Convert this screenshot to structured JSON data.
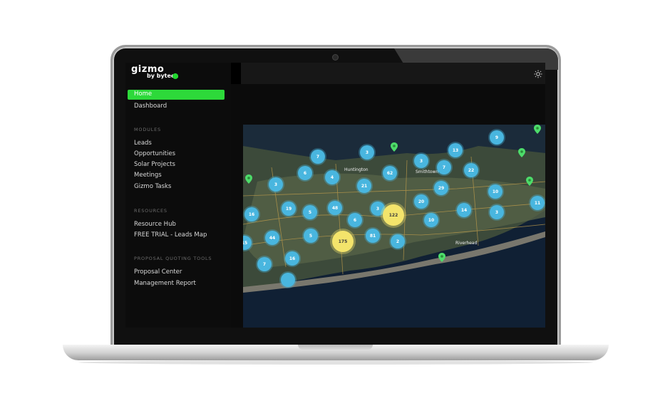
{
  "brand": {
    "name": "gizmo",
    "sub": "by bytech"
  },
  "sidebar": {
    "home": "Home",
    "dashboard": "Dashboard",
    "sections": [
      {
        "label": "MODULES",
        "items": [
          "Leads",
          "Opportunities",
          "Solar Projects",
          "Meetings",
          "Gizmo Tasks"
        ]
      },
      {
        "label": "RESOURCES",
        "items": [
          "Resource Hub",
          "FREE TRIAL - Leads Map"
        ]
      },
      {
        "label": "PROPOSAL QUOTING TOOLS",
        "items": [
          "Proposal Center",
          "Management Report"
        ]
      }
    ]
  },
  "map": {
    "labels": {
      "huntington": "Huntington",
      "smithtown": "Smithtown",
      "riverhead": "Riverhead"
    },
    "clusters": [
      "7",
      "3",
      "3",
      "13",
      "9",
      "6",
      "4",
      "62",
      "7",
      "22",
      "3",
      "21",
      "29",
      "10",
      "11",
      "19",
      "5",
      "48",
      "3",
      "20",
      "14",
      "3",
      "16",
      "122",
      "6",
      "10",
      "81",
      "2",
      "15",
      "44",
      "175",
      "5",
      "16",
      "7"
    ],
    "colors": {
      "cluster": "#49b6df",
      "large_cluster": "#f3e46b",
      "pin": "#4ddc6a",
      "accent": "#2dd93a"
    }
  },
  "icons": {
    "theme_toggle": "sun-icon",
    "pin": "map-pin-icon"
  }
}
